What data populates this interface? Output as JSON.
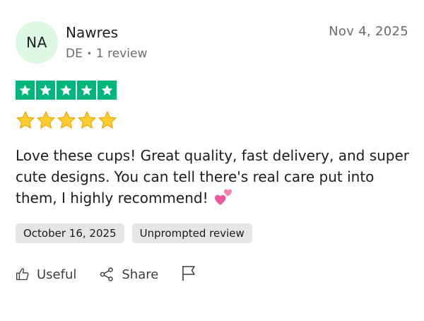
{
  "reviewer": {
    "initials": "NA",
    "name": "Nawres",
    "country": "DE",
    "separator": "•",
    "review_count": "1 review",
    "avatar_color": "#dcf9e6"
  },
  "review": {
    "date": "Nov 4, 2025",
    "rating": 5,
    "rating_color": "#00b67a",
    "emoji_rating": 5,
    "text": "Love these cups! Great quality, fast delivery, and super cute designs. You can tell there's real care put into them, I highly recommend!",
    "text_emoji": "two-hearts-icon"
  },
  "tags": {
    "experience_date": "October 16, 2025",
    "type": "Unprompted review"
  },
  "actions": {
    "useful_label": "Useful",
    "share_label": "Share",
    "flag_icon": "flag-icon"
  }
}
